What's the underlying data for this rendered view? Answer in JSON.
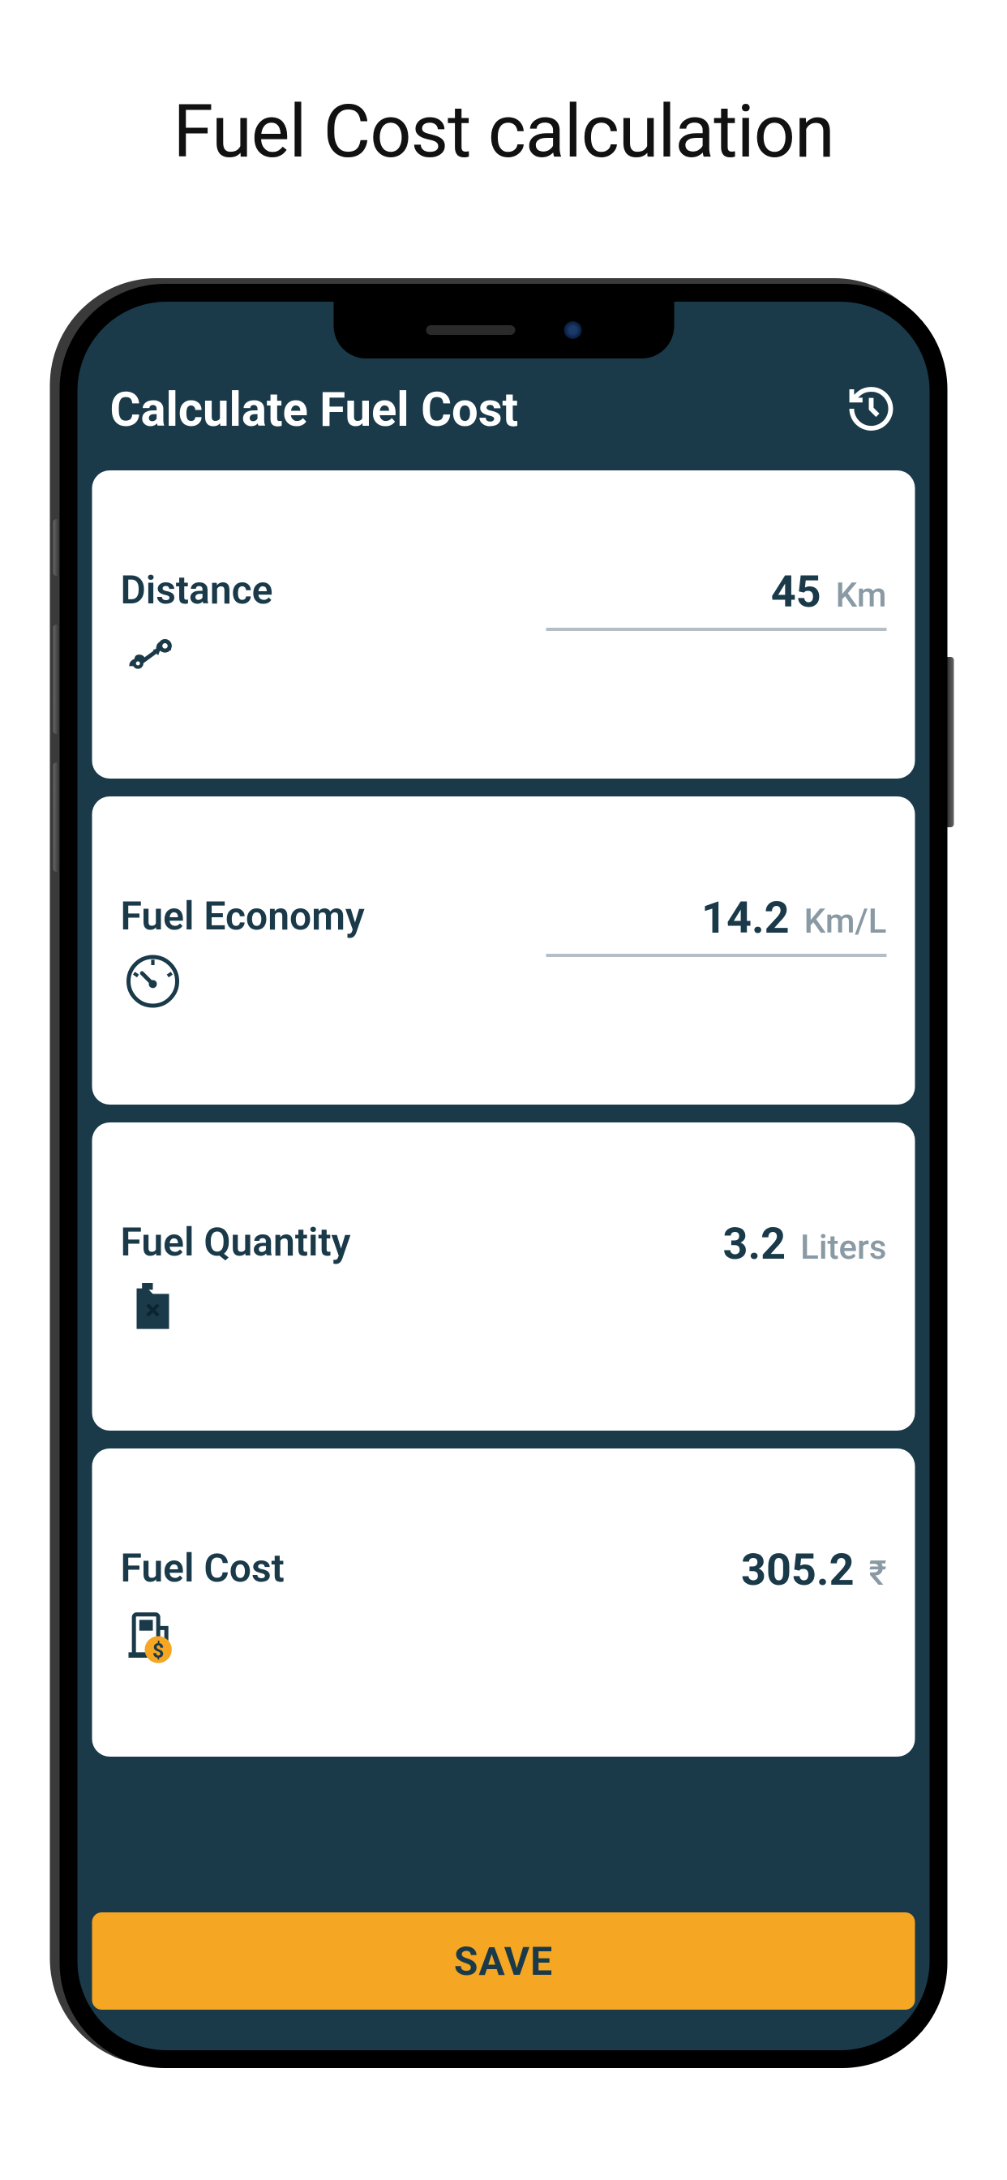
{
  "page": {
    "title": "Fuel Cost calculation"
  },
  "header": {
    "title": "Calculate Fuel Cost"
  },
  "cards": {
    "distance": {
      "label": "Distance",
      "value": "45",
      "unit": "Km"
    },
    "economy": {
      "label": "Fuel Economy",
      "value": "14.2",
      "unit": "Km/L"
    },
    "quantity": {
      "label": "Fuel Quantity",
      "value": "3.2",
      "unit": "Liters"
    },
    "cost": {
      "label": "Fuel Cost",
      "value": "305.2",
      "unit": "₹"
    }
  },
  "footer": {
    "save_label": "SAVE"
  }
}
